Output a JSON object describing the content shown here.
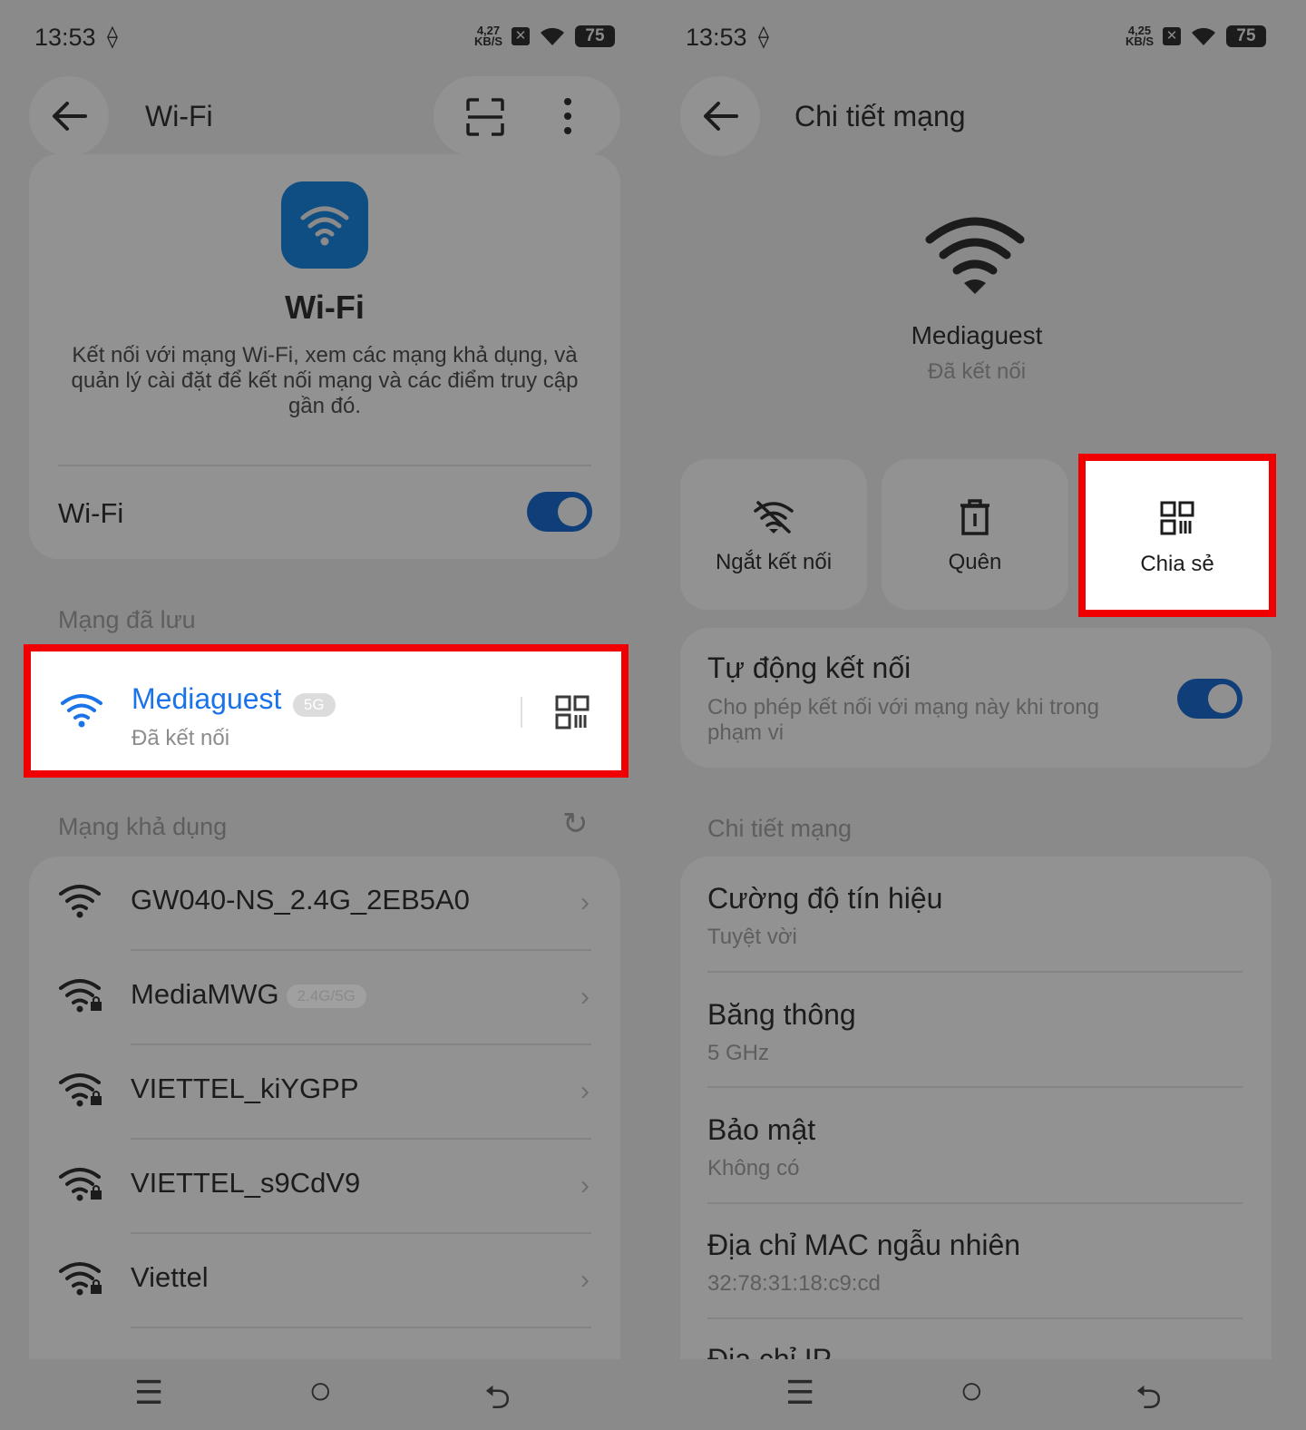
{
  "left": {
    "status": {
      "time": "13:53",
      "loc": "⟠",
      "speed_top": "4,27",
      "speed_bottom": "KB/S",
      "x": "✕",
      "battery": "75"
    },
    "header": {
      "back": "←",
      "title": "Wi-Fi"
    },
    "intro": {
      "title": "Wi-Fi",
      "description": "Kết nối với mạng Wi-Fi, xem các mạng khả dụng, và quản lý cài đặt để kết nối mạng và các điểm truy cập gần đó.",
      "toggle_label": "Wi-Fi"
    },
    "saved": {
      "section_label": "Mạng đã lưu",
      "name": "Mediaguest",
      "badge": "5G",
      "status": "Đã kết nối"
    },
    "available": {
      "section_label": "Mạng khả dụng",
      "refresh": "↻",
      "networks": [
        {
          "name": "GW040-NS_2.4G_2EB5A0",
          "badge": "",
          "locked": false
        },
        {
          "name": "MediaMWG",
          "badge": "2.4G/5G",
          "locked": true
        },
        {
          "name": "VIETTEL_kiYGPP",
          "badge": "",
          "locked": true
        },
        {
          "name": "VIETTEL_s9CdV9",
          "badge": "",
          "locked": true
        },
        {
          "name": "Viettel",
          "badge": "",
          "locked": true
        }
      ],
      "chevron": "›"
    },
    "nav": {
      "menu": "☰",
      "home": "○",
      "back": "⮌"
    }
  },
  "right": {
    "status": {
      "time": "13:53",
      "loc": "⟠",
      "speed_top": "4,25",
      "speed_bottom": "KB/S",
      "x": "✕",
      "battery": "75"
    },
    "header": {
      "back": "←",
      "title": "Chi tiết mạng"
    },
    "network": {
      "name": "Mediaguest",
      "status": "Đã kết nối"
    },
    "actions": [
      {
        "label": "Ngắt kết nối",
        "icon": "wifi-off-icon"
      },
      {
        "label": "Quên",
        "icon": "trash-icon"
      },
      {
        "label": "Chia sẻ",
        "icon": "qr-code-icon"
      }
    ],
    "auto_connect": {
      "title": "Tự động kết nối",
      "description": "Cho phép kết nối với mạng này khi trong phạm vi"
    },
    "details": {
      "section_label": "Chi tiết mạng",
      "rows": [
        {
          "title": "Cường độ tín hiệu",
          "value": "Tuyệt vời"
        },
        {
          "title": "Băng thông",
          "value": "5 GHz"
        },
        {
          "title": "Bảo mật",
          "value": "Không có"
        },
        {
          "title": "Địa chỉ MAC ngẫu nhiên",
          "value": "32:78:31:18:c9:cd"
        },
        {
          "title": "Địa chỉ IP",
          "value": ""
        }
      ]
    },
    "nav": {
      "menu": "☰",
      "home": "○",
      "back": "⮌"
    }
  }
}
